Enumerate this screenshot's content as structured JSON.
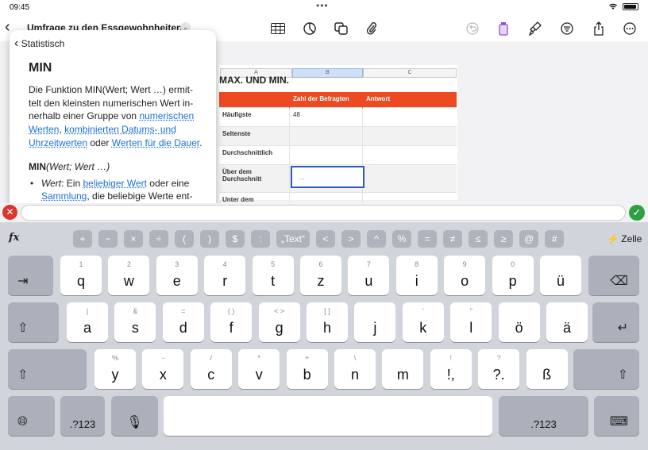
{
  "status": {
    "time": "09:45"
  },
  "toolbar": {
    "title": "Umfrage zu den Essgewohnheiten"
  },
  "help": {
    "nav_label": "Statistisch",
    "heading": "MIN",
    "p1_a": "Die Funktion MIN(Wert; Wert …) ermit-telt den kleinsten numerischen Wert in-nerhalb einer Gruppe von ",
    "link1": "numerischen Werten",
    "p1_b": ", ",
    "link2": "kombinierten Datums- und Uhrzeitwerten",
    "p1_c": " oder ",
    "link3": "Werten für die Dauer",
    "p1_d": ".",
    "syntax_fn": "MIN",
    "syntax_args": "(Wert; Wert …)",
    "bullet_term": "Wert",
    "bullet_text": ": Ein ",
    "bullet_link1": "beliebiger Wert",
    "bullet_text2": " oder eine ",
    "bullet_link2": "Sammlung",
    "bullet_text3": ", die beliebige Werte ent-"
  },
  "sheet": {
    "col_headers": [
      "A",
      "B",
      "C"
    ],
    "title": "MAX. UND MIN.",
    "header_row": [
      "",
      "Zahl der Befragten",
      "Antwort"
    ],
    "rows": [
      {
        "label": "Häufigste",
        "value": "48",
        "answer": ""
      },
      {
        "label": "Seltenste",
        "value": "…",
        "answer": ""
      },
      {
        "label": "Durchschnittlich",
        "value": "",
        "answer": ""
      },
      {
        "label": "Über dem Durchschnitt",
        "value": "",
        "answer": ""
      },
      {
        "label": "Unter dem",
        "value": "",
        "answer": ""
      }
    ]
  },
  "keyboard": {
    "fx": "fx",
    "ops": [
      "+",
      "−",
      "×",
      "÷",
      "(",
      ")",
      "$",
      ":",
      "„Text“",
      "<",
      ">",
      "^",
      "%",
      "=",
      "≠",
      "≤",
      "≥",
      "@",
      "#"
    ],
    "cell_label": "Zelle",
    "row1": [
      [
        "1",
        "q"
      ],
      [
        "2",
        "w"
      ],
      [
        "3",
        "e"
      ],
      [
        "4",
        "r"
      ],
      [
        "5",
        "t"
      ],
      [
        "6",
        "z"
      ],
      [
        "7",
        "u"
      ],
      [
        "8",
        "i"
      ],
      [
        "9",
        "o"
      ],
      [
        "0",
        "p"
      ],
      [
        "",
        "ü"
      ]
    ],
    "row2": [
      [
        "|",
        "a"
      ],
      [
        "&",
        "s"
      ],
      [
        "=",
        "d"
      ],
      [
        "(  )",
        "f"
      ],
      [
        "<  >",
        "g"
      ],
      [
        "[  ]",
        "h"
      ],
      [
        "",
        "j"
      ],
      [
        "'",
        "k"
      ],
      [
        "\"",
        "l"
      ],
      [
        "",
        "ö"
      ],
      [
        "",
        "ä"
      ]
    ],
    "row3": [
      [
        "%",
        "y"
      ],
      [
        "-",
        "x"
      ],
      [
        "/",
        "c"
      ],
      [
        "*",
        "v"
      ],
      [
        "+",
        "b"
      ],
      [
        "\\",
        "n"
      ],
      [
        "",
        "m"
      ],
      [
        "!",
        "!,"
      ],
      [
        "?",
        "?."
      ],
      [
        "",
        "ß"
      ]
    ],
    "num_label": ".?123"
  }
}
